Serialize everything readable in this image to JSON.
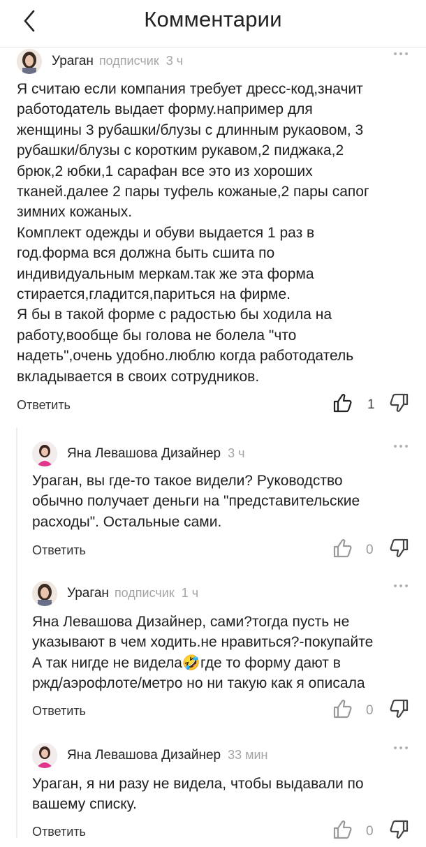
{
  "header": {
    "title": "Комментарии"
  },
  "comments": [
    {
      "author": "Ураган",
      "badge": "подписчик",
      "time": "3 ч",
      "text": "Я считаю если компания требует дресс-код,значит\nработодатель выдает форму.например для\nженщины 3 рубашки/блузы с длинным рукаовом, 3\nрубашки/блузы с коротким рукавом,2 пиджака,2\nбрюк,2 юбки,1 сарафан все это из хороших\nтканей.далее 2 пары туфель кожаные,2 пары сапог\nзимних кожаных.\nКомплект одежды и обуви выдается 1 раз в\nгод.форма вся должна быть сшита по\nиндивидуальным меркам.так же эта форма\nстирается,гладится,париться на фирме.\nЯ бы в такой форме с радостью бы ходила на\nработу,вообще бы голова не болела \"что\nнадеть\",очень удобно.люблю когда работодатель\nвкладывается в своих сотрудников.",
      "reply_label": "Ответить",
      "likes": "1"
    },
    {
      "author": "Яна Левашова Дизайнер",
      "badge": "",
      "time": "3 ч",
      "text": "Ураган, вы где-то такое видели? Руководство\nобычно получает деньги на \"представительские\nрасходы\". Остальные сами.",
      "reply_label": "Ответить",
      "likes": "0"
    },
    {
      "author": "Ураган",
      "badge": "подписчик",
      "time": "1 ч",
      "text": "Яна Левашова Дизайнер, сами?тогда пусть не\nуказывают в чем ходить.не нравиться?-покупайте\nА так нигде не видела🤣где то форму дают в\nржд/аэрофлоте/метро но ни такую как я описала",
      "reply_label": "Ответить",
      "likes": "0"
    },
    {
      "author": "Яна Левашова Дизайнер",
      "badge": "",
      "time": "33 мин",
      "text": "Ураган, я ни разу не видела, чтобы выдавали по\nвашему списку.",
      "reply_label": "Ответить",
      "likes": "0"
    }
  ],
  "icons": {
    "back": "chevron-left-icon",
    "more": "more-dots-icon",
    "like": "thumbs-up-icon",
    "dislike": "thumbs-down-icon"
  },
  "colors": {
    "accent_like": "#222222",
    "muted": "#a4a4a4"
  }
}
